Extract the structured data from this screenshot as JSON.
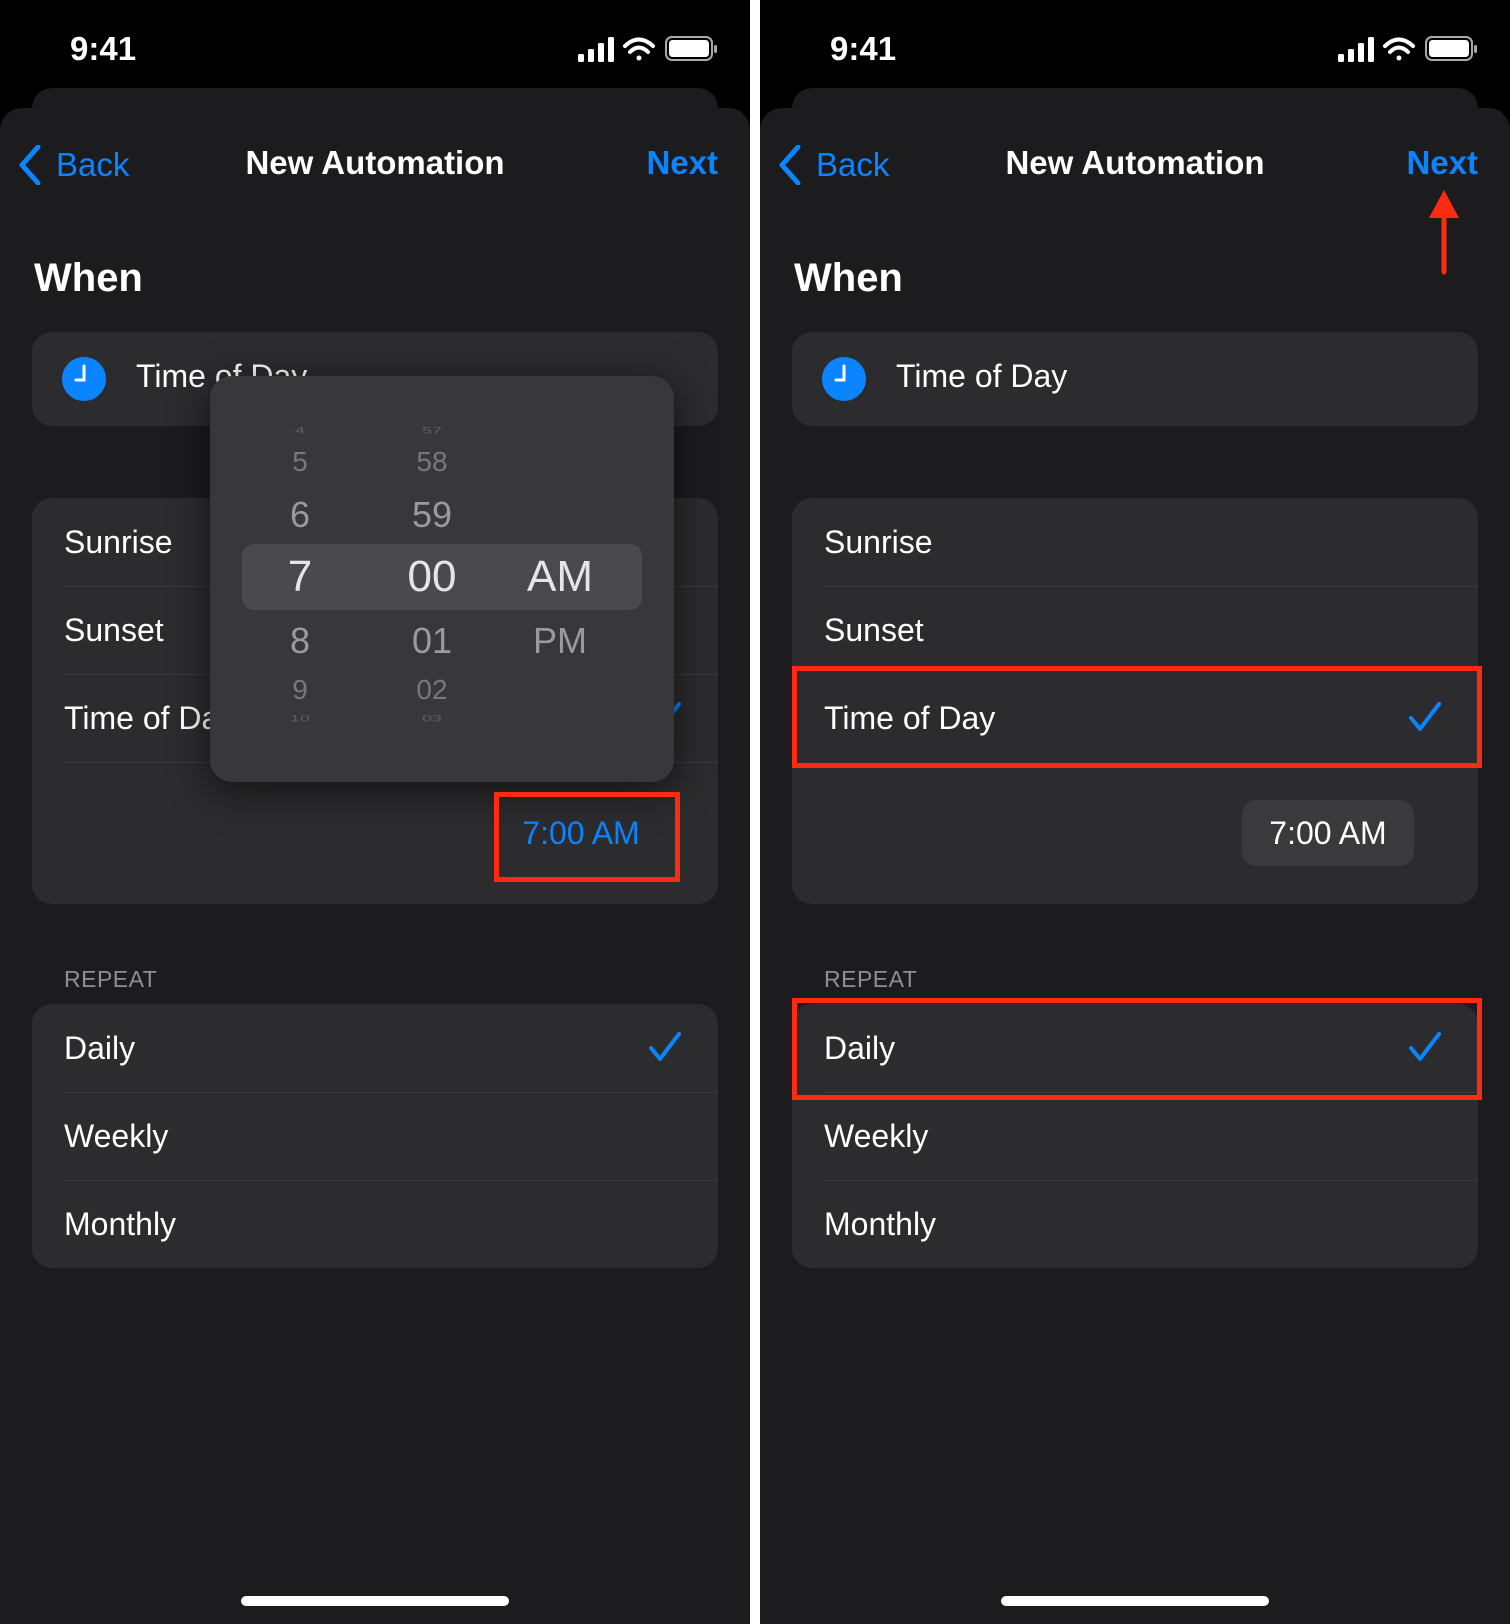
{
  "colors": {
    "accent": "#0a84ff",
    "annotation": "#ff2a12",
    "background": "#000000",
    "sheet": "#1c1c1e",
    "card": "#2c2c2e"
  },
  "left": {
    "status": {
      "time": "9:41"
    },
    "nav": {
      "back": "Back",
      "title": "New Automation",
      "next": "Next"
    },
    "heading": "When",
    "trigger": {
      "label": "Time of Day",
      "icon": "clock-icon"
    },
    "options": [
      {
        "label": "Sunrise"
      },
      {
        "label": "Sunset"
      },
      {
        "label": "Time of Day",
        "selected": true
      }
    ],
    "time_button": "7:00 AM",
    "picker": {
      "hours": [
        "4",
        "5",
        "6",
        "7",
        "8",
        "9",
        "10"
      ],
      "minutes": [
        "57",
        "58",
        "59",
        "00",
        "01",
        "02",
        "03"
      ],
      "periods": [
        "AM",
        "PM"
      ],
      "selected": {
        "hour": "7",
        "minute": "00",
        "period": "AM"
      }
    },
    "repeat": {
      "label": "REPEAT",
      "items": [
        {
          "label": "Daily",
          "selected": true
        },
        {
          "label": "Weekly"
        },
        {
          "label": "Monthly"
        }
      ]
    }
  },
  "right": {
    "status": {
      "time": "9:41"
    },
    "nav": {
      "back": "Back",
      "title": "New Automation",
      "next": "Next"
    },
    "heading": "When",
    "trigger": {
      "label": "Time of Day",
      "icon": "clock-icon"
    },
    "options": [
      {
        "label": "Sunrise"
      },
      {
        "label": "Sunset"
      },
      {
        "label": "Time of Day",
        "selected": true
      }
    ],
    "time_button": "7:00 AM",
    "repeat": {
      "label": "REPEAT",
      "items": [
        {
          "label": "Daily",
          "selected": true
        },
        {
          "label": "Weekly"
        },
        {
          "label": "Monthly"
        }
      ]
    }
  }
}
